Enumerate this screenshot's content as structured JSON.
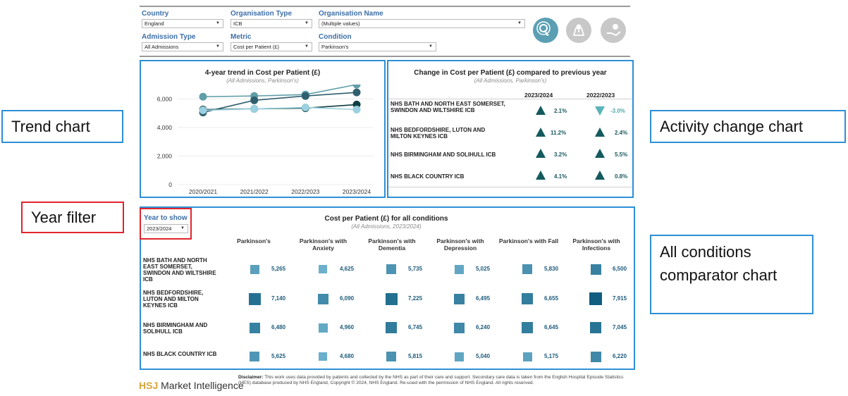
{
  "filters": {
    "country": {
      "label": "Country",
      "value": "England"
    },
    "org_type": {
      "label": "Organisation Type",
      "value": "ICB"
    },
    "org_name": {
      "label": "Organisation Name",
      "value": "(Multiple values)"
    },
    "admission_type": {
      "label": "Admission Type",
      "value": "All Admissions"
    },
    "metric": {
      "label": "Metric",
      "value": "Cost per Patient (£)"
    },
    "condition": {
      "label": "Condition",
      "value": "Parkinson's"
    }
  },
  "trend": {
    "title": "4-year trend in Cost per Patient (£)",
    "subtitle": "(All Admissions, Parkinson's)"
  },
  "change": {
    "title": "Change in Cost per Patient (£) compared to previous year",
    "subtitle": "(All Admissions, Parkinson's)",
    "col1": "2023/2024",
    "col2": "2022/2023",
    "rows": [
      {
        "org": "NHS BATH AND NORTH EAST SOMERSET, SWINDON AND WILTSHIRE ICB",
        "c1": "2.1%",
        "c2": "-3.0%"
      },
      {
        "org": "NHS BEDFORDSHIRE, LUTON AND MILTON KEYNES ICB",
        "c1": "11.2%",
        "c2": "2.4%"
      },
      {
        "org": "NHS BIRMINGHAM AND SOLIHULL ICB",
        "c1": "3.2%",
        "c2": "5.5%"
      },
      {
        "org": "NHS BLACK COUNTRY ICB",
        "c1": "4.1%",
        "c2": "0.8%"
      }
    ]
  },
  "conditions": {
    "title": "Cost per Patient (£) for all conditions",
    "subtitle": "(All Admissions, 2023/2024)",
    "year_label": "Year to show",
    "year_value": "2023/2024",
    "headers": [
      "Parkinson's",
      "Parkinson's with Anxiety",
      "Parkinson's with Dementia",
      "Parkinson's with Depression",
      "Parkinson's with Fall",
      "Parkinson's with Infections"
    ],
    "rows": [
      {
        "org": "NHS BATH AND NORTH EAST SOMERSET, SWINDON AND WILTSHIRE ICB",
        "values": [
          "5,265",
          "4,625",
          "5,735",
          "5,025",
          "5,830",
          "6,500"
        ]
      },
      {
        "org": "NHS BEDFORDSHIRE, LUTON AND MILTON KEYNES ICB",
        "values": [
          "7,140",
          "6,090",
          "7,225",
          "6,495",
          "6,655",
          "7,915"
        ]
      },
      {
        "org": "NHS BIRMINGHAM AND SOLIHULL ICB",
        "values": [
          "6,480",
          "4,960",
          "6,745",
          "6,240",
          "6,645",
          "7,045"
        ]
      },
      {
        "org": "NHS BLACK COUNTRY ICB",
        "values": [
          "5,625",
          "4,680",
          "5,815",
          "5,040",
          "5,175",
          "6,220"
        ]
      }
    ]
  },
  "callouts": {
    "trend": "Trend chart",
    "activity": "Activity change chart",
    "year": "Year filter",
    "conditions": "All conditions comparator chart"
  },
  "footer": {
    "brand_hsj": "HSJ",
    "brand_rest": "Market Intelligence",
    "disclaimer_label": "Disclaimer:",
    "disclaimer_text": "This work uses data provided by patients and collected by the NHS as part of their care and support. Secondary care data is taken from the English Hospital Episode Statistics (HES) database produced by NHS England, Copyright © 2024, NHS England. Re-used with the permission of NHS England. All rights reserved."
  },
  "colors": {
    "accent": "#2e8fd6",
    "red": "#e0242b",
    "dark_teal": "#145a5e",
    "light_teal": "#5ab4b8"
  },
  "chart_data": {
    "type": "line",
    "x": [
      "2020/2021",
      "2021/2022",
      "2022/2023",
      "2023/2024"
    ],
    "ylim": [
      0,
      7000
    ],
    "yticks": [
      "0",
      "2,000",
      "4,000",
      "6,000"
    ],
    "series": [
      {
        "color": "#5f9ea8",
        "values": [
          6150,
          6200,
          6300,
          7000
        ]
      },
      {
        "color": "#2f5f6e",
        "values": [
          5050,
          5900,
          6200,
          6450
        ]
      },
      {
        "color": "#0f3f42",
        "values": [
          5250,
          5300,
          5350,
          5600
        ]
      },
      {
        "color": "#9ad0e0",
        "values": [
          5200,
          5300,
          5400,
          5250
        ]
      }
    ]
  }
}
